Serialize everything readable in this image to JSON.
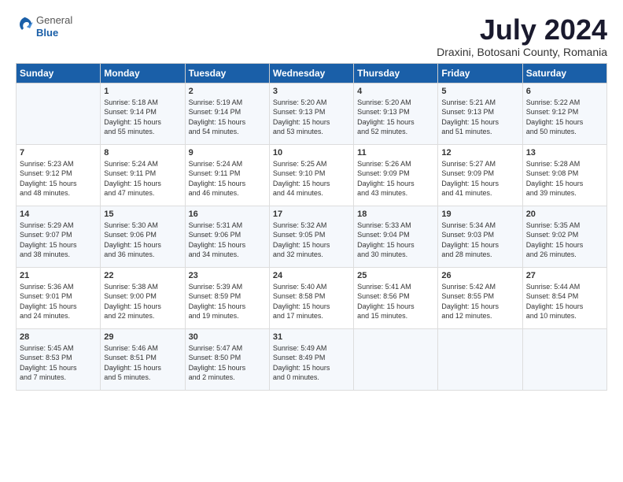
{
  "header": {
    "logo_general": "General",
    "logo_blue": "Blue",
    "title": "July 2024",
    "subtitle": "Draxini, Botosani County, Romania"
  },
  "calendar": {
    "days_of_week": [
      "Sunday",
      "Monday",
      "Tuesday",
      "Wednesday",
      "Thursday",
      "Friday",
      "Saturday"
    ],
    "weeks": [
      [
        {
          "day": "",
          "content": ""
        },
        {
          "day": "1",
          "content": "Sunrise: 5:18 AM\nSunset: 9:14 PM\nDaylight: 15 hours\nand 55 minutes."
        },
        {
          "day": "2",
          "content": "Sunrise: 5:19 AM\nSunset: 9:14 PM\nDaylight: 15 hours\nand 54 minutes."
        },
        {
          "day": "3",
          "content": "Sunrise: 5:20 AM\nSunset: 9:13 PM\nDaylight: 15 hours\nand 53 minutes."
        },
        {
          "day": "4",
          "content": "Sunrise: 5:20 AM\nSunset: 9:13 PM\nDaylight: 15 hours\nand 52 minutes."
        },
        {
          "day": "5",
          "content": "Sunrise: 5:21 AM\nSunset: 9:13 PM\nDaylight: 15 hours\nand 51 minutes."
        },
        {
          "day": "6",
          "content": "Sunrise: 5:22 AM\nSunset: 9:12 PM\nDaylight: 15 hours\nand 50 minutes."
        }
      ],
      [
        {
          "day": "7",
          "content": "Sunrise: 5:23 AM\nSunset: 9:12 PM\nDaylight: 15 hours\nand 48 minutes."
        },
        {
          "day": "8",
          "content": "Sunrise: 5:24 AM\nSunset: 9:11 PM\nDaylight: 15 hours\nand 47 minutes."
        },
        {
          "day": "9",
          "content": "Sunrise: 5:24 AM\nSunset: 9:11 PM\nDaylight: 15 hours\nand 46 minutes."
        },
        {
          "day": "10",
          "content": "Sunrise: 5:25 AM\nSunset: 9:10 PM\nDaylight: 15 hours\nand 44 minutes."
        },
        {
          "day": "11",
          "content": "Sunrise: 5:26 AM\nSunset: 9:09 PM\nDaylight: 15 hours\nand 43 minutes."
        },
        {
          "day": "12",
          "content": "Sunrise: 5:27 AM\nSunset: 9:09 PM\nDaylight: 15 hours\nand 41 minutes."
        },
        {
          "day": "13",
          "content": "Sunrise: 5:28 AM\nSunset: 9:08 PM\nDaylight: 15 hours\nand 39 minutes."
        }
      ],
      [
        {
          "day": "14",
          "content": "Sunrise: 5:29 AM\nSunset: 9:07 PM\nDaylight: 15 hours\nand 38 minutes."
        },
        {
          "day": "15",
          "content": "Sunrise: 5:30 AM\nSunset: 9:06 PM\nDaylight: 15 hours\nand 36 minutes."
        },
        {
          "day": "16",
          "content": "Sunrise: 5:31 AM\nSunset: 9:06 PM\nDaylight: 15 hours\nand 34 minutes."
        },
        {
          "day": "17",
          "content": "Sunrise: 5:32 AM\nSunset: 9:05 PM\nDaylight: 15 hours\nand 32 minutes."
        },
        {
          "day": "18",
          "content": "Sunrise: 5:33 AM\nSunset: 9:04 PM\nDaylight: 15 hours\nand 30 minutes."
        },
        {
          "day": "19",
          "content": "Sunrise: 5:34 AM\nSunset: 9:03 PM\nDaylight: 15 hours\nand 28 minutes."
        },
        {
          "day": "20",
          "content": "Sunrise: 5:35 AM\nSunset: 9:02 PM\nDaylight: 15 hours\nand 26 minutes."
        }
      ],
      [
        {
          "day": "21",
          "content": "Sunrise: 5:36 AM\nSunset: 9:01 PM\nDaylight: 15 hours\nand 24 minutes."
        },
        {
          "day": "22",
          "content": "Sunrise: 5:38 AM\nSunset: 9:00 PM\nDaylight: 15 hours\nand 22 minutes."
        },
        {
          "day": "23",
          "content": "Sunrise: 5:39 AM\nSunset: 8:59 PM\nDaylight: 15 hours\nand 19 minutes."
        },
        {
          "day": "24",
          "content": "Sunrise: 5:40 AM\nSunset: 8:58 PM\nDaylight: 15 hours\nand 17 minutes."
        },
        {
          "day": "25",
          "content": "Sunrise: 5:41 AM\nSunset: 8:56 PM\nDaylight: 15 hours\nand 15 minutes."
        },
        {
          "day": "26",
          "content": "Sunrise: 5:42 AM\nSunset: 8:55 PM\nDaylight: 15 hours\nand 12 minutes."
        },
        {
          "day": "27",
          "content": "Sunrise: 5:44 AM\nSunset: 8:54 PM\nDaylight: 15 hours\nand 10 minutes."
        }
      ],
      [
        {
          "day": "28",
          "content": "Sunrise: 5:45 AM\nSunset: 8:53 PM\nDaylight: 15 hours\nand 7 minutes."
        },
        {
          "day": "29",
          "content": "Sunrise: 5:46 AM\nSunset: 8:51 PM\nDaylight: 15 hours\nand 5 minutes."
        },
        {
          "day": "30",
          "content": "Sunrise: 5:47 AM\nSunset: 8:50 PM\nDaylight: 15 hours\nand 2 minutes."
        },
        {
          "day": "31",
          "content": "Sunrise: 5:49 AM\nSunset: 8:49 PM\nDaylight: 15 hours\nand 0 minutes."
        },
        {
          "day": "",
          "content": ""
        },
        {
          "day": "",
          "content": ""
        },
        {
          "day": "",
          "content": ""
        }
      ]
    ]
  }
}
